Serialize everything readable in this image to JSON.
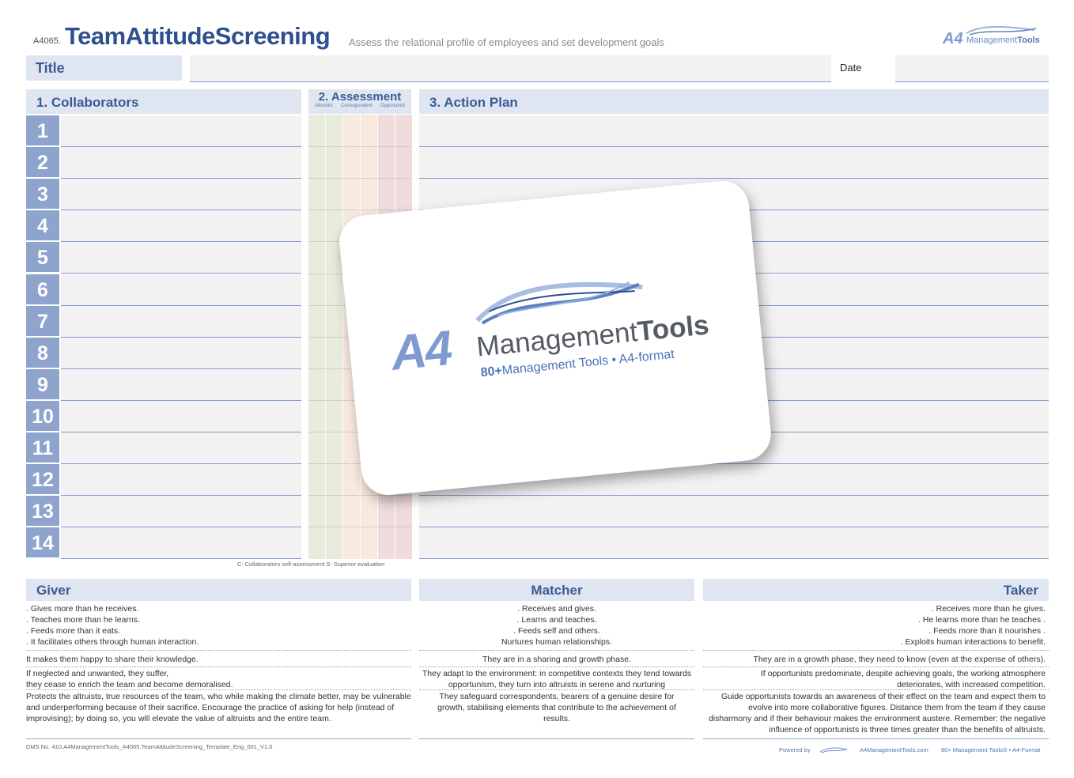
{
  "header": {
    "code": "A4065.",
    "title": "TeamAttitudeScreening",
    "subtitle": "Assess the relational profile of employees and set development goals",
    "brand_a4": "A4",
    "brand_management": "Management",
    "brand_tools": "Tools"
  },
  "form": {
    "title_label": "Title",
    "date_label": "Date"
  },
  "sections": {
    "collaborators": "1. Collaborators",
    "assessment": "2. Assessment",
    "assessment_cols": [
      "Altruistic",
      "Correspondent",
      "Opportunist"
    ],
    "action_plan": "3. Action Plan",
    "legend_note": "C: Collaborators self-assessment  S: Superior evaluation"
  },
  "rows": [
    "1",
    "2",
    "3",
    "4",
    "5",
    "6",
    "7",
    "8",
    "9",
    "10",
    "11",
    "12",
    "13",
    "14"
  ],
  "colors": {
    "accent": "#3b5a95",
    "band": "#dfe6f1",
    "number_cell": "#8ea4cc",
    "altruistic": "#e7ecdc",
    "correspondent": "#f8e9df",
    "opportunist": "#f0dcdc"
  },
  "categories": {
    "giver": {
      "title": "Giver",
      "traits": [
        ". Gives more than he receives.",
        ". Teaches more than he learns.",
        ". Feeds more than it eats.",
        ". It facilitates others through human interaction."
      ],
      "phase": "It makes them happy to share their knowledge.",
      "risk": "If neglected and unwanted, they suffer,\nthey cease to enrich the team and become demoralised.",
      "advice": "Protects the altruists, true resources of the team, who while making the climate better, may be vulnerable and underperforming because of their sacrifice. Encourage the practice of asking for help (instead of improvising); by doing so, you will elevate the value of altruists and the entire team."
    },
    "matcher": {
      "title": "Matcher",
      "traits": [
        ". Receives and gives.",
        ". Learns and teaches.",
        ". Feeds self and others.",
        "Nurtures human relationships."
      ],
      "phase": "They are in a sharing and growth phase.",
      "risk": "They adapt to the environment: in competitive contexts they tend towards opportunism, they turn into altruists in serene and nurturing",
      "advice": "They safeguard correspondents, bearers of a genuine desire for growth, stabilising elements that contribute to the achievement of results."
    },
    "taker": {
      "title": "Taker",
      "traits": [
        ". Receives more than he gives.",
        ". He learns more than he teaches .",
        ". Feeds more than it nourishes .",
        ". Exploits human interactions to benefit."
      ],
      "phase": "They are in a growth phase, they need to know (even at the expense of others).",
      "risk": "If opportunists predominate, despite achieving goals, the working atmosphere deteriorates, with increased competition.",
      "advice": "Guide opportunists towards an awareness of their effect on the team and expect them to evolve into more collaborative figures. Distance them from the team if they cause disharmony and if their behaviour makes the environment austere. Remember: the negative influence of opportunists is three times greater than the benefits of altruists."
    }
  },
  "footer": {
    "dms": "DMS No. 410.A4ManagementTools_A4065.TeamAttitudeScreening_Template_Eng_001_V1.0",
    "powered_by": "Powered by",
    "site": "A4ManagementTools.com",
    "tagline": "80+ Management Tools® • A4-Format"
  },
  "overlay": {
    "a4": "A4",
    "management": "Management",
    "tools": "Tools",
    "tag_bold": "80+",
    "tag_rest": "Management Tools • A4-format"
  }
}
